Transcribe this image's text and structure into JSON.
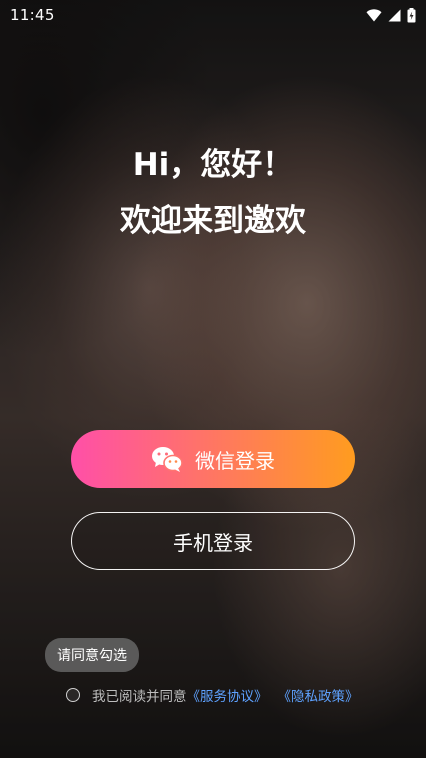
{
  "status_bar": {
    "time": "11:45",
    "icons": [
      "wifi-icon",
      "signal-icon",
      "battery-charging-icon"
    ]
  },
  "welcome": {
    "greeting": "Hi，您好！",
    "subtitle": "欢迎来到邀欢"
  },
  "buttons": {
    "wechat_login": "微信登录",
    "phone_login": "手机登录"
  },
  "tooltip": {
    "text": "请同意勾选"
  },
  "agreement": {
    "prefix": "我已阅读并同意",
    "service_link": "《服务协议》",
    "privacy_link": "《隐私政策》"
  },
  "colors": {
    "gradient_start": "#ff4fa8",
    "gradient_end": "#ff9c1f",
    "link": "#5ea2ff"
  }
}
